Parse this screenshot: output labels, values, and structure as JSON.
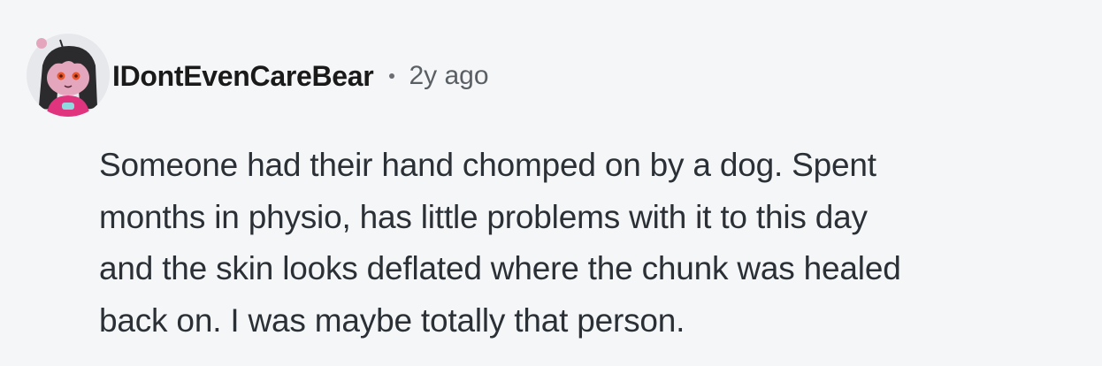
{
  "comment": {
    "author": "IDontEvenCareBear",
    "separator": "•",
    "timestamp": "2y ago",
    "avatar_icon": "snoo-avatar-icon",
    "body_lines": [
      "Someone had their hand chomped on by a dog. Spent",
      "months in physio, has little problems with it to this day",
      "and the skin looks deflated where the chunk was healed",
      "back on. I was maybe totally that person."
    ]
  },
  "colors": {
    "background": "#f5f6f7",
    "username": "#1a1a1b",
    "timestamp": "#5a5f64",
    "body": "#2a3036",
    "avatar_bg": "#e6e8ec",
    "avatar_hair": "#2b2b2e",
    "avatar_face": "#e3a6bd",
    "avatar_shirt": "#e0347f"
  }
}
